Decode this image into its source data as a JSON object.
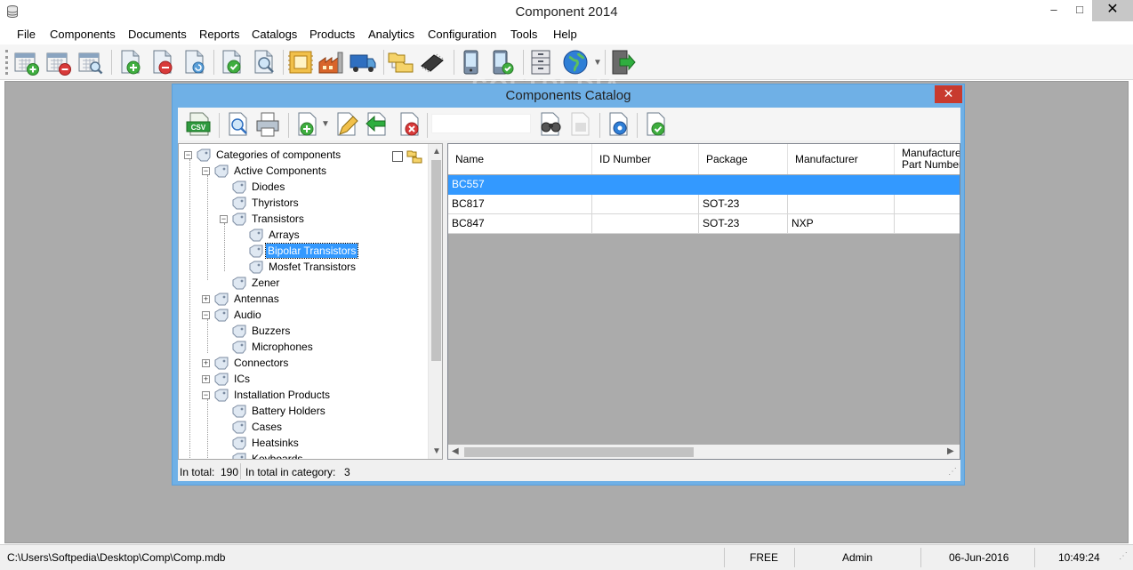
{
  "window": {
    "title": "Component 2014",
    "minimize": "–",
    "maximize": "□",
    "close": "✕"
  },
  "menu": [
    {
      "label": "File"
    },
    {
      "label": "Components"
    },
    {
      "label": "Documents"
    },
    {
      "label": "Reports"
    },
    {
      "label": "Catalogs"
    },
    {
      "label": "Products"
    },
    {
      "label": "Analytics"
    },
    {
      "label": "Configuration"
    },
    {
      "label": "Tools"
    },
    {
      "label": "Help"
    }
  ],
  "toolbar_icons": [
    "calendar-add-icon",
    "calendar-remove-icon",
    "calendar-search-icon",
    "document-add-icon",
    "document-remove-icon",
    "document-refresh-icon",
    "document-check-icon",
    "document-search-icon",
    "component-chip-icon",
    "factory-icon",
    "truck-icon",
    "folders-icon",
    "ic-chip-icon",
    "device-icon",
    "device-check-icon",
    "cabinet-icon",
    "globe-icon",
    "exit-door-icon"
  ],
  "watermark": "SOFTPEDIA",
  "dialog": {
    "title": "Components Catalog",
    "close": "✕",
    "csv_label": "CSV",
    "search": {
      "value": "",
      "placeholder": ""
    },
    "tree": {
      "root": "Categories of components",
      "nodes": [
        {
          "label": "Active Components"
        },
        {
          "label": "Diodes"
        },
        {
          "label": "Thyristors"
        },
        {
          "label": "Transistors"
        },
        {
          "label": "Arrays"
        },
        {
          "label": "Bipolar Transistors"
        },
        {
          "label": "Mosfet Transistors"
        },
        {
          "label": "Zener"
        },
        {
          "label": "Antennas"
        },
        {
          "label": "Audio"
        },
        {
          "label": "Buzzers"
        },
        {
          "label": "Microphones"
        },
        {
          "label": "Connectors"
        },
        {
          "label": "ICs"
        },
        {
          "label": "Installation Products"
        },
        {
          "label": "Battery Holders"
        },
        {
          "label": "Cases"
        },
        {
          "label": "Heatsinks"
        },
        {
          "label": "Keyboards"
        }
      ]
    },
    "grid": {
      "columns": [
        "Name",
        "ID Number",
        "Package",
        "Manufacturer",
        "Manufacturer Part Number"
      ],
      "rows": [
        [
          "BC557",
          "",
          "",
          "",
          ""
        ],
        [
          "BC817",
          "",
          "SOT-23",
          "",
          ""
        ],
        [
          "BC847",
          "",
          "SOT-23",
          "NXP",
          ""
        ]
      ]
    },
    "status": {
      "total_label": "In total:",
      "total_value": "190",
      "category_label": "In total in category:",
      "category_value": "3"
    }
  },
  "statusbar": {
    "path": "C:\\Users\\Softpedia\\Desktop\\Comp\\Comp.mdb",
    "license": "FREE",
    "user": "Admin",
    "date": "06-Jun-2016",
    "time": "10:49:24"
  },
  "colors": {
    "selection": "#3399ff",
    "dialog_frame": "#6fb0e6",
    "close_red": "#c83a2e",
    "workspace": "#ababab"
  }
}
